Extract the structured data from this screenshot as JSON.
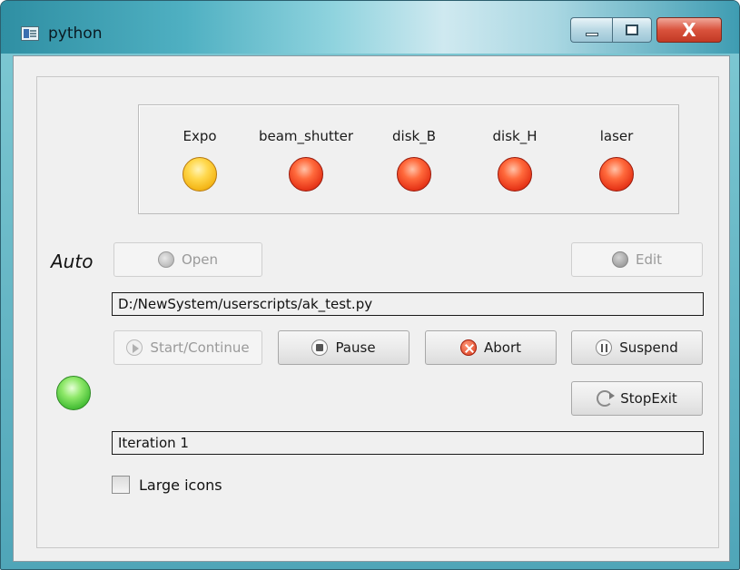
{
  "window": {
    "title": "python",
    "close_glyph": "X"
  },
  "indicators": [
    {
      "label": "Expo",
      "state": "yellow"
    },
    {
      "label": "beam_shutter",
      "state": "red"
    },
    {
      "label": "disk_B",
      "state": "red"
    },
    {
      "label": "disk_H",
      "state": "red"
    },
    {
      "label": "laser",
      "state": "red"
    }
  ],
  "mode_label": "Auto",
  "buttons": {
    "open": "Open",
    "edit": "Edit",
    "start_continue": "Start/Continue",
    "pause": "Pause",
    "abort": "Abort",
    "suspend": "Suspend",
    "stopexit": "StopExit"
  },
  "script_path": "D:/NewSystem/userscripts/ak_test.py",
  "status_text": "Iteration 1",
  "large_icons": {
    "label": "Large icons",
    "checked": false
  },
  "colors": {
    "led_yellow": "#ffd84d",
    "led_red": "#e8381a",
    "led_green": "#4cc23a",
    "title_bar": "#4fb0c2",
    "close_button": "#d9523c"
  },
  "icons": {
    "open": "open-icon",
    "edit": "edit-icon",
    "start_continue": "play-icon",
    "pause": "stop-circle-icon",
    "abort": "abort-icon",
    "suspend": "pause-icon",
    "stopexit": "refresh-icon"
  }
}
